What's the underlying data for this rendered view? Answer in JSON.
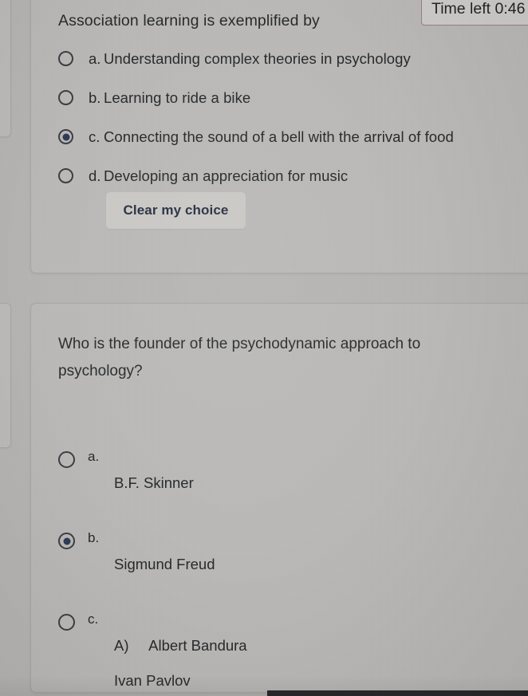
{
  "timer": {
    "text": "Time left 0:46",
    "border_color": "#9c7f86",
    "background_color": "#cfcdcb"
  },
  "theme": {
    "page_background": "#b6b5b3",
    "card_background": "#bab9b7",
    "card_border": "#a9a8a5",
    "text_color": "#26282b",
    "radio_selected_color": "#2c3a55",
    "button_background": "#cbc9c6"
  },
  "questions": [
    {
      "stem": "Association learning is exemplified by",
      "options": [
        {
          "letter": "a.",
          "text": "Understanding complex theories in psychology",
          "selected": false
        },
        {
          "letter": "b.",
          "text": "Learning to ride a bike",
          "selected": false
        },
        {
          "letter": "c.",
          "text": "Connecting the sound of a bell with the arrival of food",
          "selected": true
        },
        {
          "letter": "d.",
          "text": "Developing an appreciation for music",
          "selected": false
        }
      ],
      "clear_choice_label": "Clear my choice"
    },
    {
      "stem": "Who is the founder of the psychodynamic approach to psychology?",
      "options": [
        {
          "letter": "a.",
          "text": "B.F. Skinner",
          "selected": false
        },
        {
          "letter": "b.",
          "text": "Sigmund Freud",
          "selected": true
        },
        {
          "letter": "c.",
          "text": "A)     Albert Bandura\nIvan Pavlov",
          "selected": false
        }
      ]
    }
  ]
}
